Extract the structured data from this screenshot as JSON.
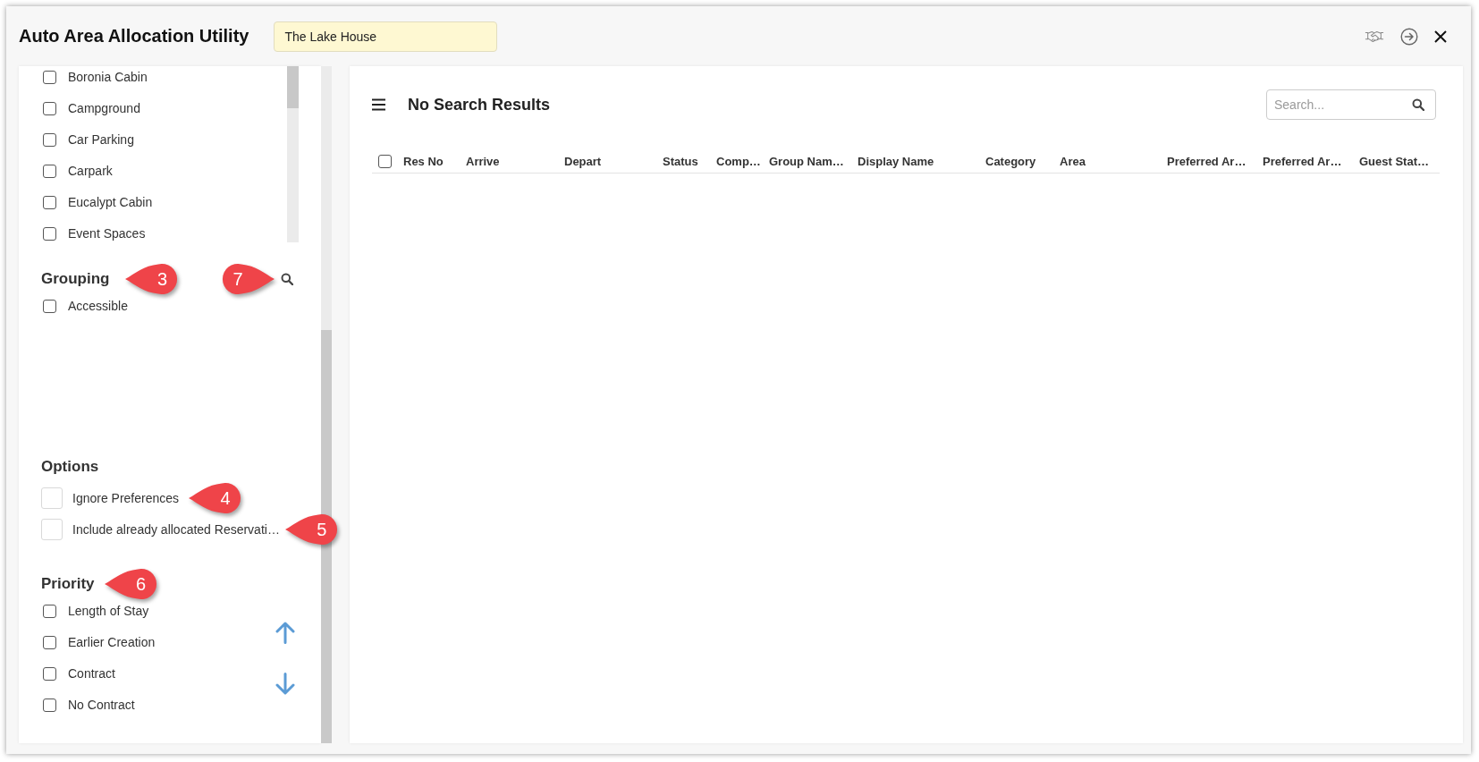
{
  "window": {
    "title": "Auto Area Allocation Utility",
    "property_field": {
      "value": "The Lake House"
    }
  },
  "filters": {
    "area_types": [
      {
        "label": "Boronia Cabin",
        "checked": false
      },
      {
        "label": "Campground",
        "checked": false
      },
      {
        "label": "Car Parking",
        "checked": false
      },
      {
        "label": "Carpark",
        "checked": false
      },
      {
        "label": "Eucalypt Cabin",
        "checked": false
      },
      {
        "label": "Event Spaces",
        "checked": false
      }
    ],
    "grouping": {
      "title": "Grouping",
      "callout": {
        "label": "3",
        "kind": "left"
      },
      "search_callout": {
        "label": "7",
        "kind": "right"
      },
      "items": [
        {
          "label": "Accessible",
          "checked": false
        }
      ]
    },
    "options": {
      "title": "Options",
      "items": [
        {
          "label": "Ignore Preferences",
          "checked": false,
          "callout": {
            "label": "4",
            "kind": "left"
          }
        },
        {
          "label": "Include already allocated Reservati…",
          "checked": false,
          "callout": {
            "label": "5",
            "kind": "left"
          }
        }
      ]
    },
    "priority": {
      "title": "Priority",
      "callout": {
        "label": "6",
        "kind": "left"
      },
      "items": [
        {
          "label": "Length of Stay",
          "checked": false
        },
        {
          "label": "Earlier Creation",
          "checked": false
        },
        {
          "label": "Contract",
          "checked": false
        },
        {
          "label": "No Contract",
          "checked": false
        }
      ]
    }
  },
  "results": {
    "title": "No Search Results",
    "search": {
      "placeholder": "Search..."
    },
    "table": {
      "select_all": {
        "checked": false
      },
      "columns": [
        "Res No",
        "Arrive",
        "Depart",
        "Status",
        "Comp…",
        "Group Nam…",
        "Display Name",
        "Category",
        "Area",
        "Preferred Ar…",
        "Preferred Ar…",
        "Guest Stat…"
      ]
    }
  }
}
